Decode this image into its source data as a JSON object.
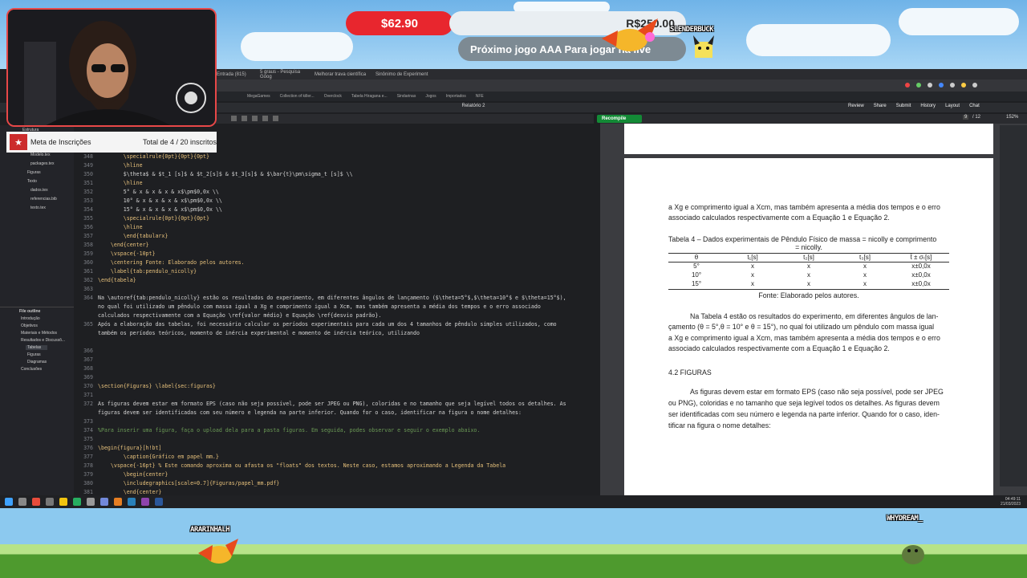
{
  "overlay": {
    "donation_amount": "$62.90",
    "goal_amount": "R$250.00",
    "next_game_text": "Próximo jogo AAA Para jogar na live",
    "sprite_top_name": "SLENDERBUCK",
    "sprite_left_name": "ARARINHALH",
    "sprite_right_name": "WHYDREAM_",
    "subs_label": "Meta de Inscrições",
    "subs_count": "Total de 4 / 20 inscritos"
  },
  "browser": {
    "tabs": [
      "Entrada (815)",
      "5 graus - Pesquisa Goog",
      "Melhorar trava científica",
      "Sinônimo de Experiment"
    ],
    "bookmarks": [
      "MegaGames",
      "Collection of killer...",
      "Overclock",
      "Tabela Hiragana e...",
      "Sindarinas",
      "Jogos",
      "Importados",
      "NFE"
    ]
  },
  "app": {
    "project_title": "Relatório 2",
    "recompile_label": "Recompile",
    "review_label": "Review",
    "share_label": "Share",
    "submit_label": "Submit",
    "history_label": "History",
    "layout_label": "Layout",
    "chat_label": "Chat",
    "page_num": "9",
    "page_total": "/ 12",
    "zoom": "152%"
  },
  "file_tree": {
    "items": [
      "Estrutura",
      "Modelo.tex",
      "packages.tex",
      "Figuras",
      "Texto",
      "dados.tex",
      "referencias.bib",
      "texto.tex"
    ]
  },
  "outline": {
    "title": "File outline",
    "items": [
      "Introdução",
      "Objetivos",
      "Materiais e Métodos",
      "Resultados e Discussõ...",
      "Tabelas",
      "Figuras",
      "Diagramas",
      "Conclusões"
    ]
  },
  "code_lines": [
    {
      "n": "",
      "t": ">{\\centering\\arraybackslash}X"
    },
    {
      "n": "",
      "t": ">{\\centering\\arraybackslash}X}"
    },
    {
      "n": "348",
      "t": "        \\specialrule{0pt}{0pt}{0pt}"
    },
    {
      "n": "349",
      "t": "        \\hline"
    },
    {
      "n": "350",
      "t": "        $\\theta$ & $t_1 [s]$ & $t_2[s]$ & $t_3[s]$ & $\\bar{t}\\pm\\sigma_t [s]$ \\\\"
    },
    {
      "n": "351",
      "t": "        \\hline"
    },
    {
      "n": "352",
      "t": "        5° & x & x & x & x$\\pm$0,0x \\\\"
    },
    {
      "n": "353",
      "t": "        10° & x & x & x & x$\\pm$0,0x \\\\"
    },
    {
      "n": "354",
      "t": "        15° & x & x & x & x$\\pm$0,0x \\\\"
    },
    {
      "n": "355",
      "t": "        \\specialrule{0pt}{0pt}{0pt}"
    },
    {
      "n": "356",
      "t": "        \\hline"
    },
    {
      "n": "357",
      "t": "        \\end{tabularx}"
    },
    {
      "n": "358",
      "t": "    \\end{center}"
    },
    {
      "n": "359",
      "t": "    \\vspace{-10pt}"
    },
    {
      "n": "360",
      "t": "    \\centering Fonte: Elaborado pelos autores."
    },
    {
      "n": "361",
      "t": "    \\label{tab:pendulo_nicolly}"
    },
    {
      "n": "362",
      "t": "\\end{tabela}"
    },
    {
      "n": "363",
      "t": ""
    },
    {
      "n": "364",
      "t": "Na \\autoref{tab:pendulo_nicolly} estão os resultados do experimento, em diferentes ângulos de lançamento ($\\theta=5°$,$\\theta=10°$ e $\\theta=15°$),"
    },
    {
      "n": "",
      "t": "no qual foi utilizado um pêndulo com massa igual a Xg e comprimento igual a Xcm, mas também apresenta a média dos tempos e o erro associado"
    },
    {
      "n": "",
      "t": "calculados respectivamente com a Equação \\ref{valor médio} e Equação \\ref{desvio padrão}."
    },
    {
      "n": "365",
      "t": "Após a elaboração das tabelas, foi necessário calcular os períodos experimentais para cada um dos 4 tamanhos de pêndulo simples utilizados, como"
    },
    {
      "n": "",
      "t": "também os períodos teóricos, momento de inércia experimental e momento de inércia teórico, utilizando"
    },
    {
      "n": "",
      "t": ""
    },
    {
      "n": "366",
      "t": ""
    },
    {
      "n": "367",
      "t": ""
    },
    {
      "n": "368",
      "t": ""
    },
    {
      "n": "369",
      "t": ""
    },
    {
      "n": "370",
      "t": "\\section{Figuras} \\label{sec:figuras}"
    },
    {
      "n": "371",
      "t": ""
    },
    {
      "n": "372",
      "t": "As figuras devem estar em formato EPS (caso não seja possível, pode ser JPEG ou PNG), coloridas e no tamanho que seja legível todos os detalhes. As"
    },
    {
      "n": "",
      "t": "figuras devem ser identificadas com seu número e legenda na parte inferior. Quando for o caso, identificar na figura o nome detalhes:"
    },
    {
      "n": "373",
      "t": ""
    },
    {
      "n": "374",
      "t": "%Para inserir uma figura, faça o upload dela para a pasta figuras. Em seguida, podes observar e seguir o exemplo abaixo."
    },
    {
      "n": "375",
      "t": ""
    },
    {
      "n": "376",
      "t": "\\begin{figura}[h!bt]"
    },
    {
      "n": "377",
      "t": "        \\caption{Gráfico em papel mm.}"
    },
    {
      "n": "378",
      "t": "    \\vspace{-16pt} % Este comando aproxima ou afasta os \"floats\" dos textos. Neste caso, estamos aproximando a Legenda da Tabela"
    },
    {
      "n": "379",
      "t": "        \\begin{center}"
    },
    {
      "n": "380",
      "t": "        \\includegraphics[scale=0.7]{Figuras/papel_mm.pdf}"
    },
    {
      "n": "381",
      "t": "        \\end{center}"
    },
    {
      "n": "382",
      "t": "    \\label{grafico}"
    }
  ],
  "pdf": {
    "para1_l1": "a Xg e comprimento igual a Xcm, mas também apresenta a média dos tempos e o erro",
    "para1_l2": "associado calculados respectivamente com a Equação 1 e Equação 2.",
    "table_caption_l1": "Tabela 4 – Dados experimentais de Pêndulo Físico de massa = nicolly e comprimento",
    "table_caption_l2": "= nicolly.",
    "table_headers": [
      "θ",
      "t₁[s]",
      "t₂[s]",
      "t₃[s]",
      "t̄ ± σₜ[s]"
    ],
    "table_rows": [
      [
        "5°",
        "x",
        "x",
        "x",
        "x±0,0x"
      ],
      [
        "10°",
        "x",
        "x",
        "x",
        "x±0,0x"
      ],
      [
        "15°",
        "x",
        "x",
        "x",
        "x±0,0x"
      ]
    ],
    "table_source": "Fonte: Elaborado pelos autores.",
    "para2_l1": "Na Tabela 4 estão os resultados do experimento, em diferentes ângulos de lan-",
    "para2_l2": "çamento (θ = 5°,θ = 10° e θ = 15°), no qual foi utilizado um pêndulo com massa igual",
    "para2_l3": "a Xg e comprimento igual a Xcm, mas também apresenta a média dos tempos e o erro",
    "para2_l4": "associado calculados respectivamente com a Equação 1 e Equação 2.",
    "section_heading": "4.2  FIGURAS",
    "para3_l1": "As figuras devem estar em formato EPS (caso não seja possível, pode ser JPEG",
    "para3_l2": "ou PNG), coloridas e no tamanho que seja legível todos os detalhes. As figuras devem",
    "para3_l3": "ser identificadas com seu número e legenda na parte inferior. Quando for o caso, iden-",
    "para3_l4": "tificar na figura o nome detalhes:"
  },
  "clock": {
    "time": "04:49:11",
    "date": "21/03/2023"
  }
}
